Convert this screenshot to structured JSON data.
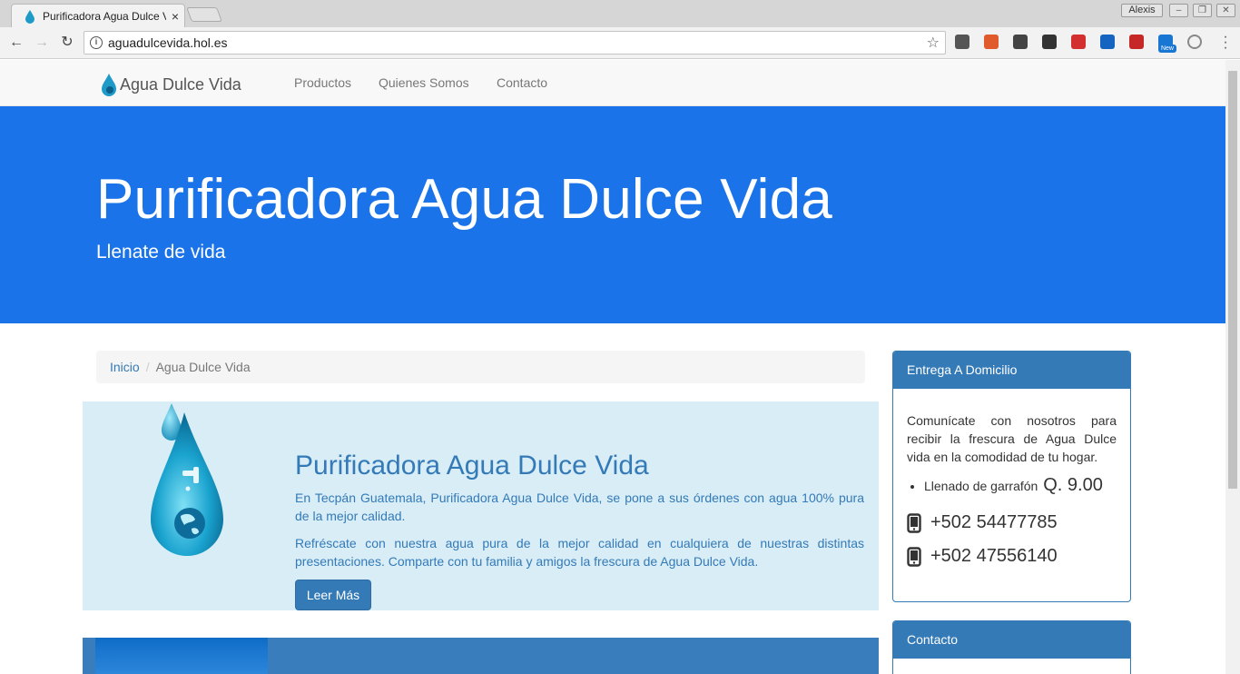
{
  "browser": {
    "tab_title": "Purificadora Agua Dulce Vida",
    "tab_close": "×",
    "user_name": "Alexis",
    "url": "aguadulcevida.hol.es",
    "window_controls": [
      "–",
      "❐",
      "✕"
    ],
    "extensions": [
      {
        "icon": "world-icon",
        "color": "#555555"
      },
      {
        "icon": "calendar-icon",
        "color": "#e05a2b"
      },
      {
        "icon": "shield-icon",
        "color": "#444444"
      },
      {
        "icon": "speedometer-icon",
        "color": "#333333"
      },
      {
        "icon": "flag-icon",
        "color": "#d32f2f"
      },
      {
        "icon": "chart-icon",
        "color": "#1565c0"
      },
      {
        "icon": "save-icon",
        "color": "#c62828"
      },
      {
        "icon": "news-icon",
        "color": "#1976d2",
        "badge": "New"
      },
      {
        "icon": "circle-icon",
        "color": "#888888"
      }
    ]
  },
  "navbar": {
    "brand": "Agua Dulce Vida",
    "links": [
      "Productos",
      "Quienes Somos",
      "Contacto"
    ]
  },
  "hero": {
    "title": "Purificadora Agua Dulce Vida",
    "subtitle": "Llenate de vida"
  },
  "breadcrumb": {
    "home": "Inicio",
    "separator": "/",
    "current": "Agua Dulce Vida"
  },
  "feature": {
    "title": "Purificadora Agua Dulce Vida",
    "paragraph1": "En Tecpán Guatemala, Purificadora Agua Dulce Vida, se pone a sus órdenes con agua 100% pura de la mejor calidad.",
    "paragraph2": "Refréscate con nuestra agua pura de la mejor calidad en cualquiera de nuestras distintas presentaciones. Comparte con tu familia y amigos la frescura de Agua Dulce Vida.",
    "button": "Leer Más"
  },
  "delivery_panel": {
    "heading": "Entrega A Domicilio",
    "text": "Comunícate con nosotros para recibir la frescura de Agua Dulce vida en la comodidad de tu hogar.",
    "item_label": "Llenado de garrafón",
    "item_price": "Q. 9.00",
    "phones": [
      "+502 54477785",
      "+502 47556140"
    ]
  },
  "contact_panel": {
    "heading": "Contacto"
  },
  "colors": {
    "hero": "#1a73e8",
    "primary": "#337ab7",
    "jumbotron": "#d9edf7"
  }
}
